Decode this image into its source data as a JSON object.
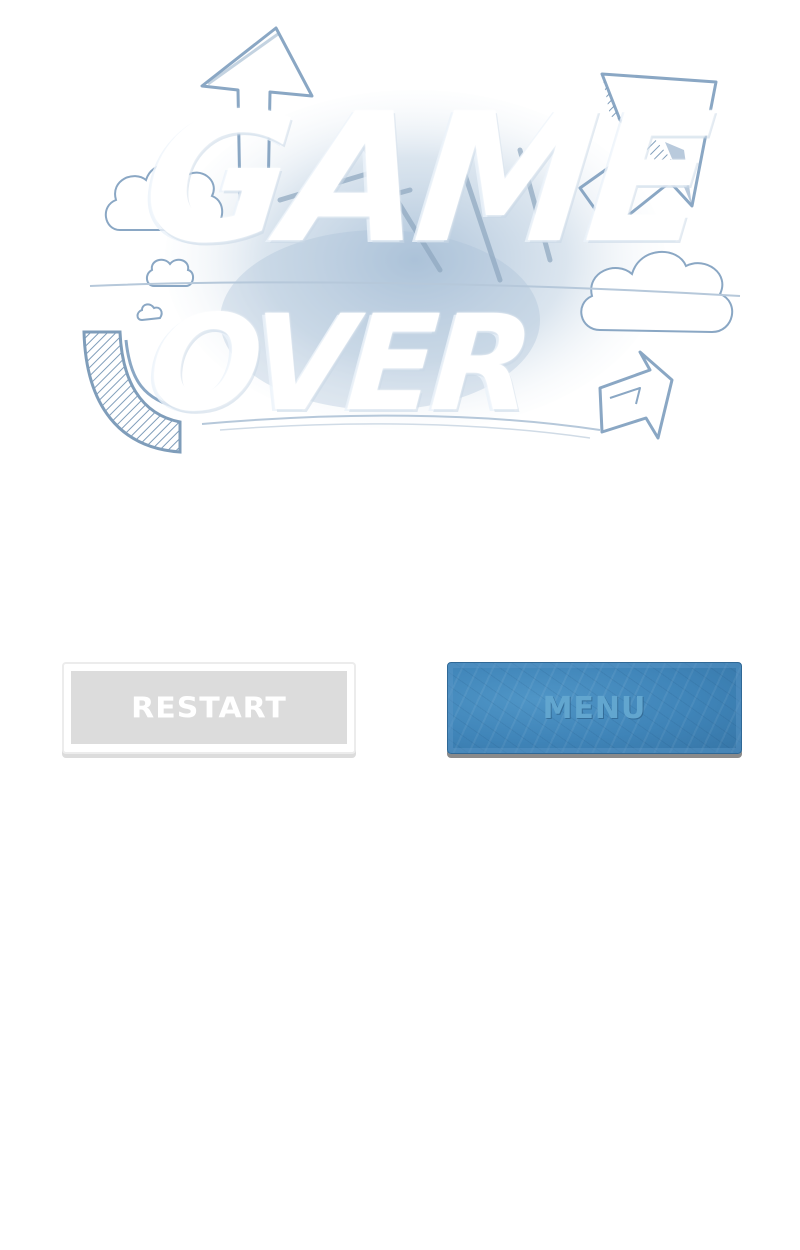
{
  "title": {
    "line1": "GAME",
    "line2": "OVER"
  },
  "buttons": {
    "restart_label": "RESTART",
    "menu_label": "menu"
  },
  "colors": {
    "sketch_blue": "#8aa7c4",
    "cloud_blue": "#b9cde0",
    "restart_fill": "#dcdcdc",
    "menu_fill": "#3f84b8",
    "menu_text": "#62a6cf"
  },
  "icons": {
    "decor": [
      "up-arrow-icon",
      "diagonal-arrow-icon",
      "curved-arrow-icon",
      "cloud-icon"
    ]
  }
}
